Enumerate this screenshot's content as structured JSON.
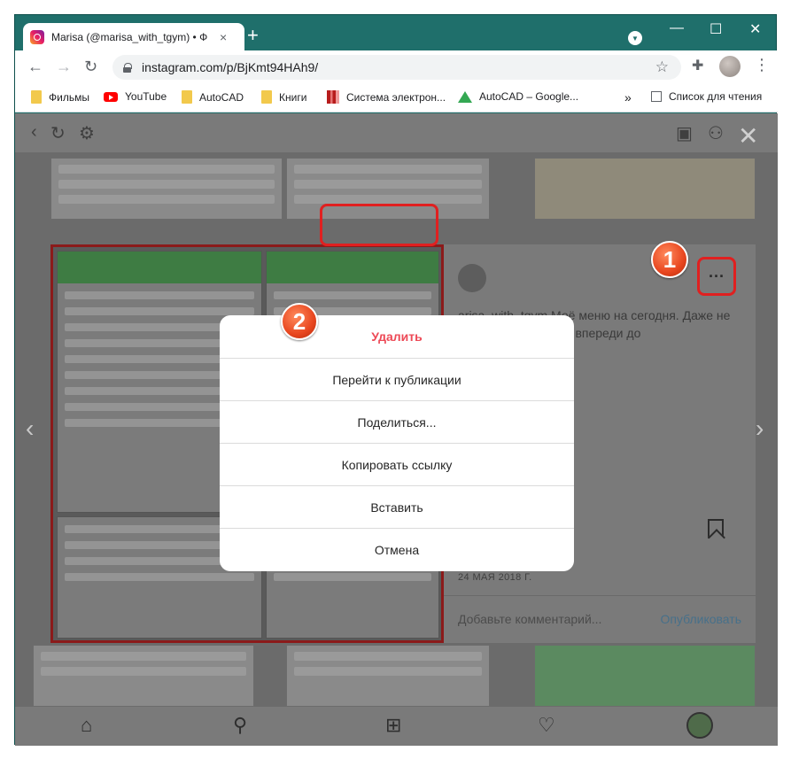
{
  "browser": {
    "tab_title": "Marisa (@marisa_with_tgym) • Ф",
    "tab_close": "×",
    "new_tab": "+",
    "url": "instagram.com/p/BjKmt94HAh9/",
    "window_controls": {
      "minimize": "—",
      "maximize": "☐",
      "close": "✕"
    }
  },
  "bookmarks": [
    {
      "label": "Фильмы",
      "icon": "folder-icon"
    },
    {
      "label": "YouTube",
      "icon": "youtube-icon"
    },
    {
      "label": "AutoCAD",
      "icon": "folder-icon"
    },
    {
      "label": "Книги",
      "icon": "folder-icon"
    },
    {
      "label": "Система электрон...",
      "icon": "system-icon"
    },
    {
      "label": "AutoCAD – Google...",
      "icon": "drive-icon"
    }
  ],
  "bookmarks_overflow": "»",
  "reading_list": "Список для чтения",
  "post": {
    "caption": "arisa_with_tgym Моё меню на сегодня. Даже не ...оте. Хотя ещё всё впереди до",
    "date": "24 МАЯ 2018 Г.",
    "comment_placeholder": "Добавьте комментарий...",
    "publish_label": "Опубликовать",
    "more_label": "···"
  },
  "modal": {
    "items": [
      {
        "label": "Удалить",
        "danger": true
      },
      {
        "label": "Перейти к публикации",
        "danger": false
      },
      {
        "label": "Поделиться...",
        "danger": false
      },
      {
        "label": "Копировать ссылку",
        "danger": false
      },
      {
        "label": "Вставить",
        "danger": false
      },
      {
        "label": "Отмена",
        "danger": false
      }
    ]
  },
  "annotations": {
    "step1": "1",
    "step2": "2"
  },
  "colors": {
    "accent_red": "#e02020",
    "danger_text": "#ed4956",
    "window_frame": "#1f6f6b"
  }
}
